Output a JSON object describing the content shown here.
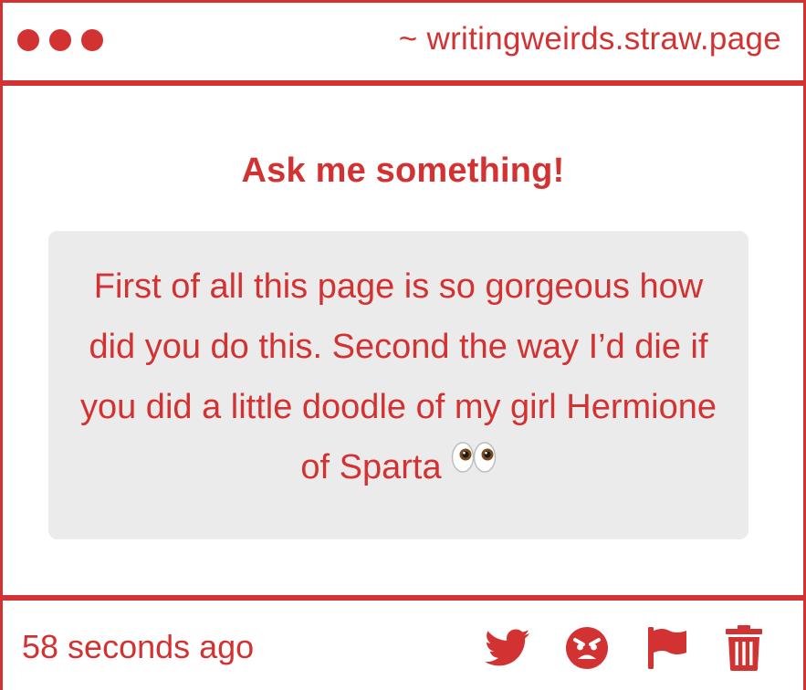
{
  "header": {
    "site_url": "~ writingweirds.straw.page"
  },
  "main": {
    "heading": "Ask me something!",
    "question": "First of all this page is so gorgeous how did you do this. Second the way I’d die if you did a little doodle of my girl Hermione of Sparta",
    "question_emoji": "eyes-emoji"
  },
  "footer": {
    "timestamp": "58 seconds ago",
    "actions": [
      "twitter-icon",
      "angry-face-icon",
      "flag-icon",
      "trash-icon"
    ]
  },
  "colors": {
    "accent": "#d23232",
    "box_background": "#ecebeb",
    "page_background": "#ffffff"
  }
}
